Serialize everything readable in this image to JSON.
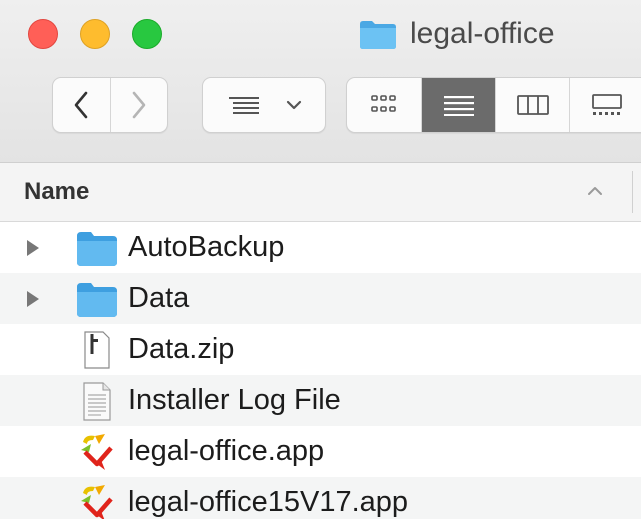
{
  "window": {
    "title": "legal-office"
  },
  "toolbar": {
    "back_icon": "chevron-left-icon",
    "forward_icon": "chevron-right-icon",
    "view_options_icon": "list-options-icon",
    "view_modes": [
      "icon-view",
      "list-view",
      "column-view",
      "gallery-view"
    ],
    "active_view_mode": "list-view"
  },
  "header": {
    "name_label": "Name",
    "sort_indicator": "chevron-up-icon"
  },
  "files": [
    {
      "name": "AutoBackup",
      "type": "folder",
      "expandable": true
    },
    {
      "name": "Data",
      "type": "folder",
      "expandable": true
    },
    {
      "name": "Data.zip",
      "type": "zip-archive",
      "expandable": false
    },
    {
      "name": "Installer Log File",
      "type": "text-document",
      "expandable": false
    },
    {
      "name": "legal-office.app",
      "type": "application",
      "expandable": false
    },
    {
      "name": "legal-office15V17.app",
      "type": "application",
      "expandable": false
    }
  ],
  "colors": {
    "folder_blue": "#5ab6ee",
    "active_view_bg": "#6b6b6b",
    "close": "#ff5f57",
    "minimize": "#febc2e",
    "zoom": "#28c840"
  }
}
